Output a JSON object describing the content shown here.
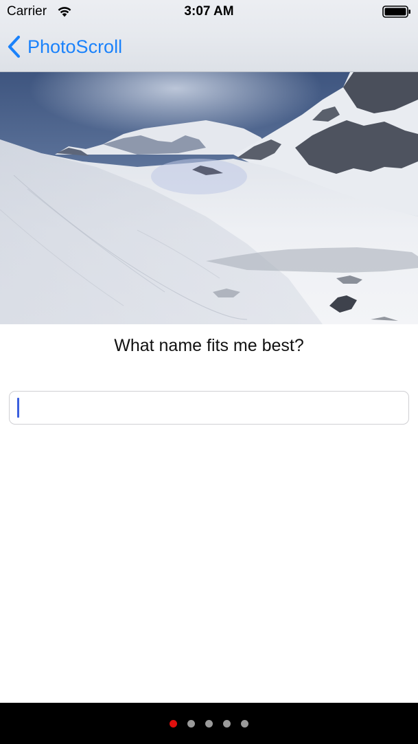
{
  "status_bar": {
    "carrier": "Carrier",
    "time": "3:07 AM",
    "wifi_icon": "wifi-icon",
    "battery_icon": "battery-icon"
  },
  "nav_bar": {
    "back_label": "PhotoScroll",
    "back_icon": "chevron-left-icon",
    "tint_color": "#1a82fb"
  },
  "content": {
    "photo": "snowy-mountain-landscape",
    "prompt": "What name fits me best?",
    "name_field": {
      "value": "",
      "placeholder": "",
      "focused": true
    }
  },
  "page_control": {
    "page_count": 5,
    "current_page": 1,
    "active_color": "#e0100e",
    "inactive_color": "#9a9a9a"
  }
}
